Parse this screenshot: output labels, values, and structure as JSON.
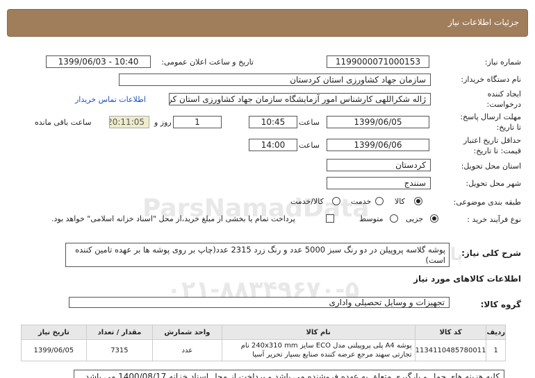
{
  "header": {
    "title": "جزئیات اطلاعات نیاز"
  },
  "fields": {
    "need_number_label": "شماره نیاز:",
    "need_number": "1199000071000153",
    "announce_label": "تاریخ و ساعت اعلان عمومی:",
    "announce_value": "1399/06/03 - 10:40",
    "buyer_label": "نام دستگاه خریدار:",
    "buyer_value": "سازمان جهاد کشاورزی استان کردستان",
    "creator_label": "ایجاد کننده درخواست:",
    "creator_value": "ژاله شکراللهی کارشناس امور آزمایشگاه سازمان جهاد کشاورزی استان کردستان",
    "contact_link": "اطلاعات تماس خریدار",
    "reply_label": "مهلت ارسال پاسخ: تا تاریخ:",
    "reply_date": "1399/06/05",
    "time_label": "ساعت",
    "reply_time": "10:45",
    "days_value": "1",
    "days_label": "روز و",
    "remaining_timer": "20:11:05",
    "remaining_label": "ساعت باقی مانده",
    "validity_label": "حداقل تاریخ اعتبار قیمت: تا تاریخ:",
    "validity_date": "1399/06/06",
    "validity_time": "14:00",
    "province_label": "استان محل تحویل:",
    "province_value": "کردستان",
    "city_label": "شهر محل تحویل:",
    "city_value": "سنندج",
    "category_label": "طبقه بندی موضوعی:",
    "category_options": [
      "کالا",
      "خدمت",
      "کالا/خدمت"
    ],
    "process_label": "نوع فرآیند خرید :",
    "process_options": [
      "جزیی",
      "متوسط"
    ],
    "payment_note": "پرداخت تمام یا بخشی از مبلغ خرید،از محل \"اسناد خزانه اسلامی\" خواهد بود."
  },
  "summary": {
    "label": "شرح کلی نیاز:",
    "text": "پوشه گلاسه پروپیلن در دو رنگ سبز 5000 عدد و رنگ زرد 2315 عدد(چاپ بر روی پوشه ها بر عهده تامین کننده است)"
  },
  "goods": {
    "section_title": "اطلاعات کالاهای مورد نیاز",
    "group_label": "گروه کالا:",
    "group_value": "تجهیزات و وسایل تحصیلی واداری",
    "columns": [
      "ردیف",
      "کد کالا",
      "نام کالا",
      "واحد شمارش",
      "مقدار / تعداد",
      "تاریخ نیاز"
    ],
    "rows": [
      {
        "row": "1",
        "code": "1134110485780011",
        "name": "پوشه A4 پلی پروپیلنی مدل ECO سایز 240x310 mm نام تجارتی سهند مرجع عرضه کننده صنایع بسپار تحریر آسیا",
        "unit": "عدد",
        "qty": "7315",
        "date": "1399/06/05"
      }
    ]
  },
  "buyer_notes": {
    "text": "کلیه هزینه های حمل و بارگیری متعلق به عهده فروشنده می باشد و پرداخت از محل اسناد خزانه 1400/08/17 می باشد"
  },
  "watermark": {
    "brand": "ParsNamadData",
    "line1": "پایگاه اطلاع رسانی مناقصه و مزایده",
    "line2": "۰۲۱-۸۸۳۴۹۶۷۰-۵"
  }
}
